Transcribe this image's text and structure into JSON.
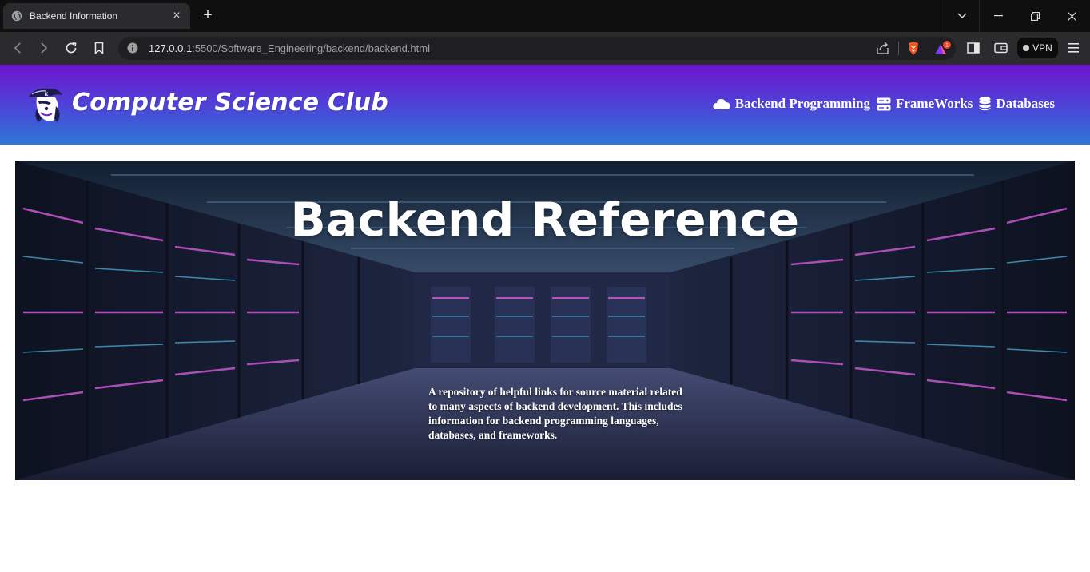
{
  "browser": {
    "tab_title": "Backend Information",
    "url_host": "127.0.0.1",
    "url_rest": ":5500/Software_Engineering/backend/backend.html",
    "vpn_label": "VPN",
    "notification_count": "1"
  },
  "header": {
    "club_name": "Computer Science Club",
    "nav": [
      {
        "label": "Backend Programming",
        "icon": "cloud-icon"
      },
      {
        "label": "FrameWorks",
        "icon": "server-icon"
      },
      {
        "label": "Databases",
        "icon": "database-icon"
      }
    ]
  },
  "hero": {
    "title": "Backend Reference",
    "description": "A repository of helpful links for source material related to many aspects of backend development. This includes information for backend programming languages, databases, and frameworks."
  },
  "colors": {
    "header_gradient_top": "#6e14cf",
    "header_gradient_bottom": "#2d78d6",
    "browser_dark": "#0f0f10",
    "toolbar": "#2b2b2e"
  }
}
